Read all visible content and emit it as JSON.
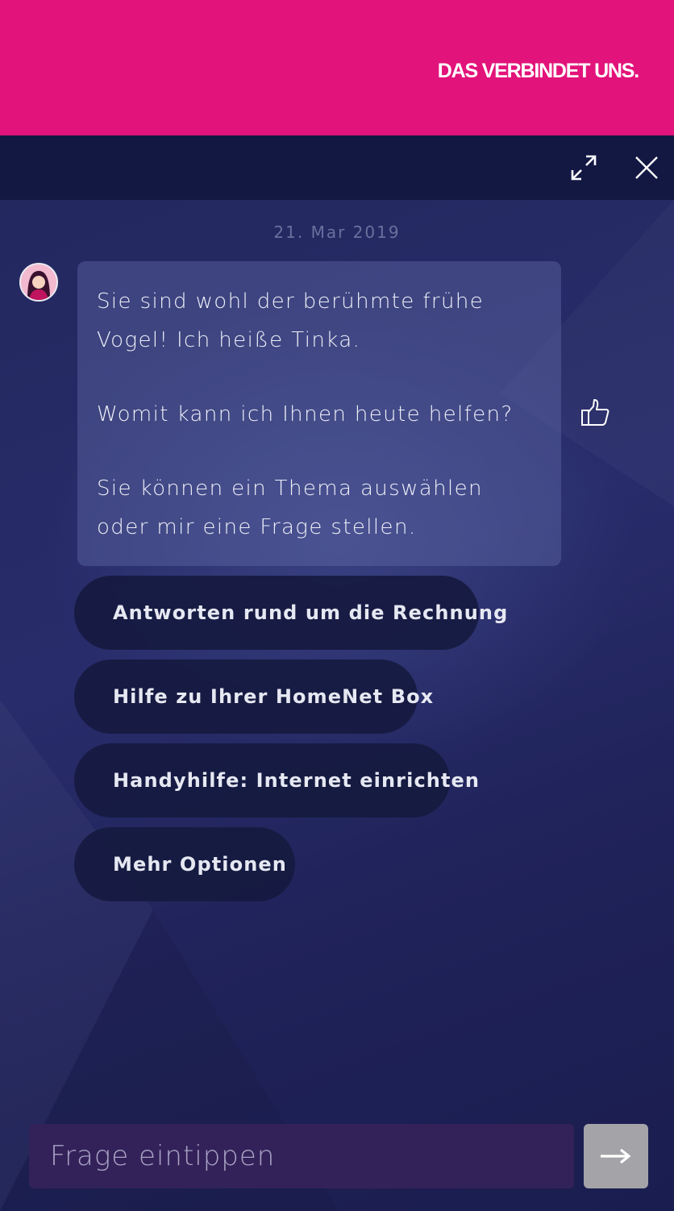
{
  "brand": {
    "slogan": "DAS VERBINDET UNS.",
    "color": "#e2137a"
  },
  "header": {
    "expand_icon": "expand-icon",
    "close_icon": "close-icon",
    "background": "#131843"
  },
  "chat": {
    "date": "21. Mar 2019",
    "bot_message": {
      "paragraphs": [
        "Sie sind wohl der berühmte frühe Vogel! Ich heiße Tinka.",
        "Womit kann ich Ihnen heute helfen?",
        "Sie können ein Thema auswählen oder mir eine Frage stellen."
      ],
      "feedback_icon": "thumbs-up-icon"
    },
    "quick_replies": [
      "Antworten rund um die Rechnung",
      "Hilfe zu Ihrer HomeNet Box",
      "Handyhilfe: Internet einrichten",
      "Mehr Optionen"
    ]
  },
  "composer": {
    "placeholder": "Frage eintippen",
    "value": "",
    "send_icon": "arrow-right-icon"
  }
}
